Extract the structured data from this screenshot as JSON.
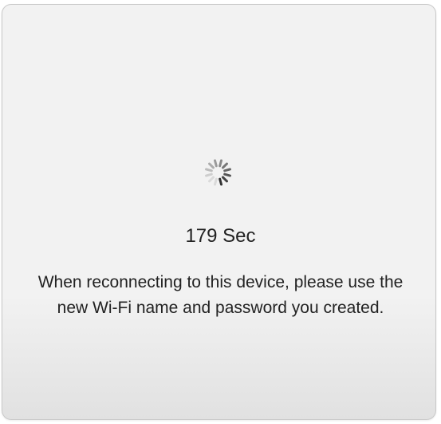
{
  "dialog": {
    "spinner_icon": "loading-spinner-icon",
    "timer_text": "179 Sec",
    "message": "When reconnecting to this device, please use the new Wi-Fi name and password you created."
  }
}
